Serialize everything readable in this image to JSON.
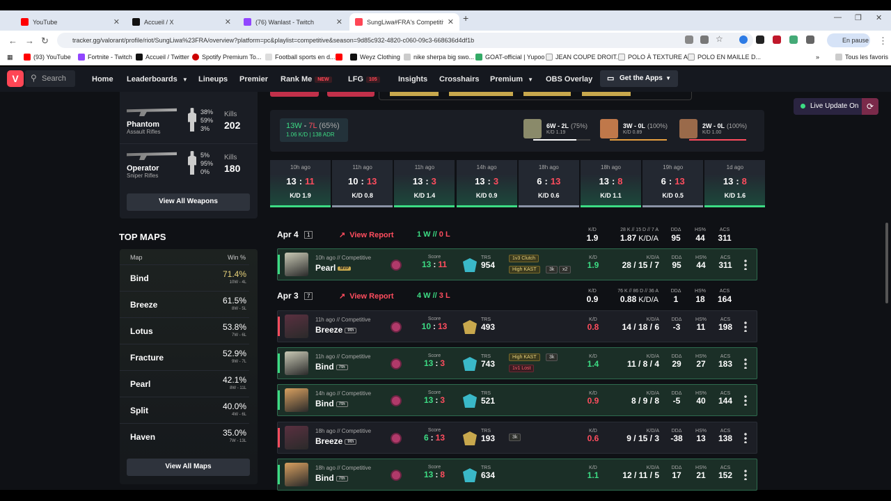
{
  "browser": {
    "tabs": [
      {
        "title": "YouTube",
        "color": "#ff0000"
      },
      {
        "title": "Accueil / X",
        "color": "#111111"
      },
      {
        "title": "(76) Wanlast - Twitch",
        "color": "#9146ff"
      },
      {
        "title": "SungLiwa#FRA's Competitive M",
        "color": "#ff4655"
      }
    ],
    "url": "tracker.gg/valorant/profile/riot/SungLiwa%23FRA/overview?platform=pc&playlist=competitive&season=9d85c932-4820-c060-09c3-668636d4df1b",
    "profile": "En pause",
    "bookmarks": [
      "(93) YouTube",
      "Fortnite - Twitch",
      "Accueil / Twitter",
      "Spotify Premium To...",
      "Football sports en d...",
      "Weyz Clothing",
      "nike sherpa big swo...",
      "GOAT-official | Yupoo",
      "JEAN COUPE DROIT...",
      "POLO À TEXTURE A...",
      "POLO EN MAILLE D..."
    ],
    "bookmarks_all": "Tous les favoris"
  },
  "site": {
    "search": "Search",
    "nav": [
      "Home",
      "Leaderboards",
      "Lineups",
      "Premier",
      "Rank Me",
      "LFG",
      "Insights",
      "Crosshairs",
      "Premium",
      "OBS Overlay"
    ],
    "new_tag": "NEW",
    "lfg_count": "105",
    "get_apps": "Get the Apps",
    "live": "Live Update On"
  },
  "weapons": [
    {
      "name": "Phantom",
      "category": "Assault Rifles",
      "pcts": [
        "38%",
        "59%",
        "3%"
      ],
      "kills_label": "Kills",
      "kills": "202"
    },
    {
      "name": "Operator",
      "category": "Sniper Rifles",
      "pcts": [
        "5%",
        "95%",
        "0%"
      ],
      "kills_label": "Kills",
      "kills": "180"
    }
  ],
  "view_all_weapons": "View All Weapons",
  "top_maps": {
    "title": "TOP MAPS",
    "col_map": "Map",
    "col_win": "Win %",
    "rows": [
      {
        "name": "Bind",
        "pct": "71.4%",
        "rec": "10W - 4L",
        "color": "#e8d27a"
      },
      {
        "name": "Breeze",
        "pct": "61.5%",
        "rec": "8W - 5L",
        "color": "#ffffff"
      },
      {
        "name": "Lotus",
        "pct": "53.8%",
        "rec": "7W - 6L",
        "color": "#ffffff"
      },
      {
        "name": "Fracture",
        "pct": "52.9%",
        "rec": "9W - 7L",
        "color": "#ffffff"
      },
      {
        "name": "Pearl",
        "pct": "42.1%",
        "rec": "8W - 11L",
        "color": "#ffffff"
      },
      {
        "name": "Split",
        "pct": "40.0%",
        "rec": "4W - 6L",
        "color": "#ffffff"
      },
      {
        "name": "Haven",
        "pct": "35.0%",
        "rec": "7W - 13L",
        "color": "#ffffff"
      }
    ],
    "view_all": "View All Maps"
  },
  "summary": {
    "w": "13W",
    "sep": " - ",
    "l": "7L",
    "pct": "(65%)",
    "sub": "1.06 K/D | 138 ADR",
    "agents": [
      {
        "rec": "6W - 2L",
        "pct": "(75%)",
        "kd": "K/D 1.19",
        "fill": 0.75,
        "color": "#ffffff"
      },
      {
        "rec": "3W - 0L",
        "pct": "(100%)",
        "kd": "K/D 0.89",
        "fill": 1.0,
        "color": "#e8a040"
      },
      {
        "rec": "2W - 0L",
        "pct": "(100%)",
        "kd": "K/D 1.00",
        "fill": 1.0,
        "color": "#ff4d5e"
      }
    ]
  },
  "recent": [
    {
      "ago": "10h ago",
      "a": "13",
      "b": "11",
      "kd": "K/D 1.9",
      "win": true
    },
    {
      "ago": "11h ago",
      "a": "10",
      "b": "13",
      "kd": "K/D 0.8",
      "win": false
    },
    {
      "ago": "11h ago",
      "a": "13",
      "b": "3",
      "kd": "K/D 1.4",
      "win": true
    },
    {
      "ago": "14h ago",
      "a": "13",
      "b": "3",
      "kd": "K/D 0.9",
      "win": true
    },
    {
      "ago": "18h ago",
      "a": "6",
      "b": "13",
      "kd": "K/D 0.6",
      "win": false
    },
    {
      "ago": "18h ago",
      "a": "13",
      "b": "8",
      "kd": "K/D 1.1",
      "win": true
    },
    {
      "ago": "19h ago",
      "a": "6",
      "b": "13",
      "kd": "K/D 0.5",
      "win": false
    },
    {
      "ago": "1d ago",
      "a": "13",
      "b": "8",
      "kd": "K/D 1.6",
      "win": true
    }
  ],
  "days": [
    {
      "date": "Apr 4",
      "count": "1",
      "view": "View Report",
      "w": "1 W",
      "sep": " // ",
      "l": "0 L",
      "kd_l": "K/D",
      "kd": "1.9",
      "kda_l": "28 K // 15 D // 7 A",
      "kda": "1.87",
      "kda_u": "K/D/A",
      "dd_l": "DDΔ",
      "dd": "95",
      "hs_l": "HS%",
      "hs": "44",
      "acs_l": "ACS",
      "acs": "311"
    },
    {
      "date": "Apr 3",
      "count": "7",
      "view": "View Report",
      "w": "4 W",
      "sep": " // ",
      "l": "3 L",
      "kd_l": "K/D",
      "kd": "0.9",
      "kda_l": "76 K // 86 D // 36 A",
      "kda": "0.88",
      "kda_u": "K/D/A",
      "dd_l": "DDΔ",
      "dd": "1",
      "hs_l": "HS%",
      "hs": "18",
      "acs_l": "ACS",
      "acs": "164"
    }
  ],
  "matches": [
    {
      "ago": "10h ago // Competitive",
      "map": "Pearl",
      "tag": "MVP",
      "score_l": "Score",
      "a": "13",
      "b": "11",
      "win": true,
      "trs_l": "TRS",
      "trs": "954",
      "badges": [
        "1v3 Clutch",
        "High KAST",
        "3k",
        "x2"
      ],
      "kd": "1.9",
      "kda": "28 / 15 / 7",
      "dd": "95",
      "hs": "44",
      "acs": "311"
    },
    {
      "ago": "11h ago // Competitive",
      "map": "Breeze",
      "tag": "9th",
      "score_l": "Score",
      "a": "10",
      "b": "13",
      "win": false,
      "trs_l": "TRS",
      "trs": "493",
      "badges": [],
      "kd": "0.8",
      "kda": "14 / 18 / 6",
      "dd": "-3",
      "hs": "11",
      "acs": "198"
    },
    {
      "ago": "11h ago // Competitive",
      "map": "Bind",
      "tag": "7th",
      "score_l": "Score",
      "a": "13",
      "b": "3",
      "win": true,
      "trs_l": "TRS",
      "trs": "743",
      "badges": [
        "High KAST",
        "3k",
        "1v1 Lost"
      ],
      "kd": "1.4",
      "kda": "11 / 8 / 4",
      "dd": "29",
      "hs": "27",
      "acs": "183"
    },
    {
      "ago": "14h ago // Competitive",
      "map": "Bind",
      "tag": "7th",
      "score_l": "Score",
      "a": "13",
      "b": "3",
      "win": true,
      "trs_l": "TRS",
      "trs": "521",
      "badges": [],
      "kd": "0.9",
      "kda": "8 / 9 / 8",
      "dd": "-5",
      "hs": "40",
      "acs": "144"
    },
    {
      "ago": "18h ago // Competitive",
      "map": "Breeze",
      "tag": "9th",
      "score_l": "Score",
      "a": "6",
      "b": "13",
      "win": false,
      "trs_l": "TRS",
      "trs": "193",
      "badges": [
        "3k"
      ],
      "kd": "0.6",
      "kda": "9 / 15 / 3",
      "dd": "-38",
      "hs": "13",
      "acs": "138"
    },
    {
      "ago": "18h ago // Competitive",
      "map": "Bind",
      "tag": "7th",
      "score_l": "Score",
      "a": "13",
      "b": "8",
      "win": true,
      "trs_l": "TRS",
      "trs": "634",
      "badges": [],
      "kd": "1.1",
      "kda": "12 / 11 / 5",
      "dd": "17",
      "hs": "21",
      "acs": "152"
    }
  ],
  "col_labels": {
    "kd": "K/D",
    "kda": "K/D/A",
    "dd": "DDΔ",
    "hs": "HS%",
    "acs": "ACS"
  }
}
